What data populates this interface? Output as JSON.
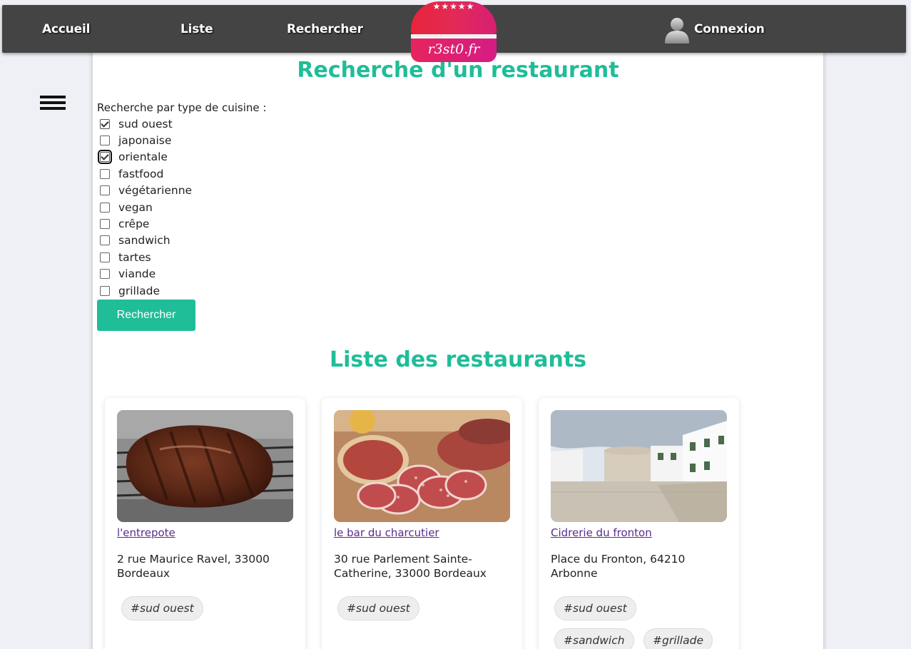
{
  "nav": {
    "accueil": "Accueil",
    "liste": "Liste",
    "rechercher": "Rechercher",
    "connexion": "Connexion"
  },
  "logo": {
    "stars": "★★★★★",
    "text": "r3st0.fr"
  },
  "search": {
    "title": "Recherche d'un restaurant",
    "label": "Recherche par type de cuisine :",
    "options": [
      {
        "label": "sud ouest",
        "checked": true
      },
      {
        "label": "japonaise",
        "checked": false
      },
      {
        "label": "orientale",
        "checked": true
      },
      {
        "label": "fastfood",
        "checked": false
      },
      {
        "label": "végétarienne",
        "checked": false
      },
      {
        "label": "vegan",
        "checked": false
      },
      {
        "label": "crêpe",
        "checked": false
      },
      {
        "label": "sandwich",
        "checked": false
      },
      {
        "label": "tartes",
        "checked": false
      },
      {
        "label": "viande",
        "checked": false
      },
      {
        "label": "grillade",
        "checked": false
      }
    ],
    "button": "Rechercher"
  },
  "list": {
    "title": "Liste des restaurants",
    "restaurants": [
      {
        "name": "l'entrepote",
        "address": "2 rue Maurice Ravel, 33000 Bordeaux",
        "tags": [
          "#sud ouest"
        ]
      },
      {
        "name": "le bar du charcutier",
        "address": "30 rue Parlement Sainte-Catherine, 33000 Bordeaux",
        "tags": [
          "#sud ouest"
        ]
      },
      {
        "name": "Cidrerie du fronton",
        "address": "Place du Fronton, 64210 Arbonne",
        "tags": [
          "#sud ouest",
          "#sandwich",
          "#grillade"
        ]
      }
    ]
  },
  "colors": {
    "accent": "#1fbd98",
    "navbar": "#444444",
    "link": "#5b2b8c"
  }
}
